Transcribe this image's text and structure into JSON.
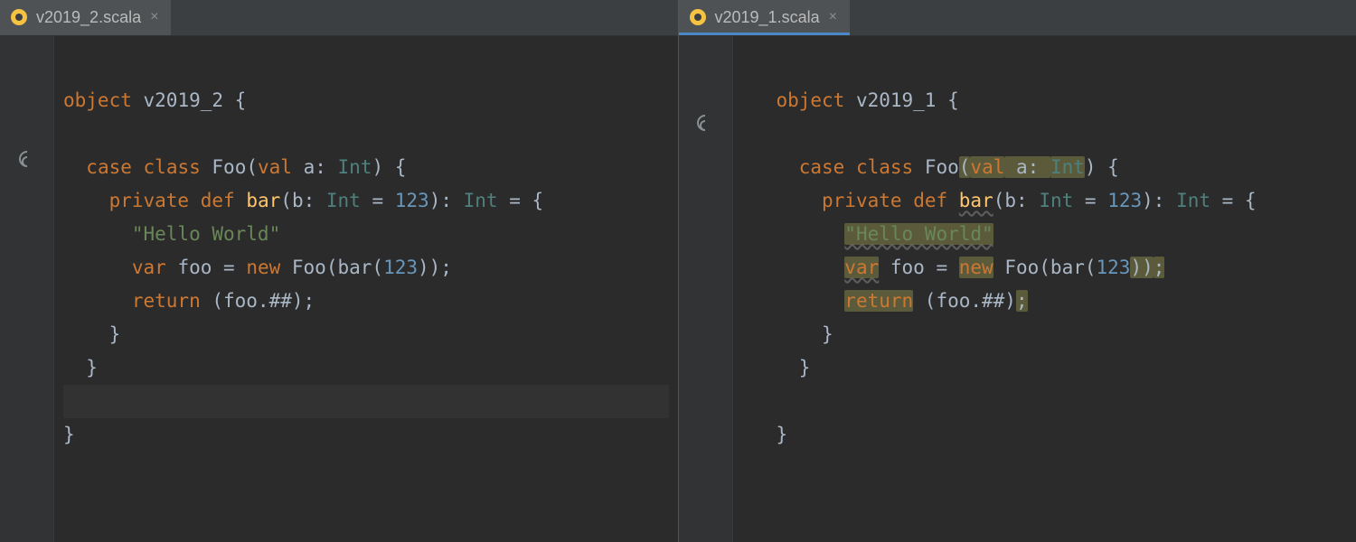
{
  "leftPane": {
    "tab": {
      "filename": "v2019_2.scala"
    },
    "code": {
      "line1": {
        "kw1": "object",
        "name": "v2019_2",
        "brace": " {"
      },
      "line3": {
        "kw1": "case",
        "kw2": "class",
        "ty": "Foo",
        "lp": "(",
        "kw3": "val",
        "prm": " a: ",
        "ty2": "Int",
        "rp": ") {"
      },
      "line4": {
        "kw1": "private",
        "kw2": "def",
        "fn": "bar",
        "lp": "(",
        "prm": "b: ",
        "ty": "Int",
        "eq": " = ",
        "num": "123",
        "rp": "): ",
        "ty2": "Int",
        "tail": " = {"
      },
      "line5": {
        "str": "\"Hello World\""
      },
      "line6": {
        "kw1": "var",
        "name": " foo = ",
        "kw2": "new",
        "ty": " Foo",
        "lp": "(",
        "fn": "bar",
        "lp2": "(",
        "num": "123",
        "rp": "));"
      },
      "line7": {
        "kw1": "return",
        "rest": " (foo.##);"
      },
      "line8": {
        "brace": "}"
      },
      "line9": {
        "brace": "}"
      },
      "line11": {
        "brace": "}"
      }
    }
  },
  "rightPane": {
    "tab": {
      "filename": "v2019_1.scala"
    },
    "code": {
      "line1": {
        "kw1": "object",
        "name": "v2019_1",
        "brace": " {"
      },
      "line3": {
        "kw1": "case",
        "kw2": "class",
        "ty": "Foo",
        "lpH": "(",
        "kw3": "val",
        "prmH": " a: ",
        "ty2H": "Int",
        "rp": ") {"
      },
      "line4": {
        "kw1": "private",
        "kw2": "def",
        "fn": "bar",
        "lp": "(",
        "prm": "b: ",
        "ty": "Int",
        "eq": " = ",
        "num": "123",
        "rp": "): ",
        "ty2": "Int",
        "tail": " = {"
      },
      "line5": {
        "str": "\"Hello World\""
      },
      "line6": {
        "kw1": "var",
        "name": " foo = ",
        "kw2": "new",
        "ty": " Foo",
        "lp": "(",
        "fn": "bar",
        "lp2": "(",
        "num": "123",
        "rpP": "))",
        "semi": ";"
      },
      "line7": {
        "kw1": "return",
        "rest_a": " (foo.##)",
        "semi": ";"
      },
      "line8": {
        "brace": "}"
      },
      "line9": {
        "brace": "}"
      },
      "line11": {
        "brace": "}"
      }
    }
  }
}
